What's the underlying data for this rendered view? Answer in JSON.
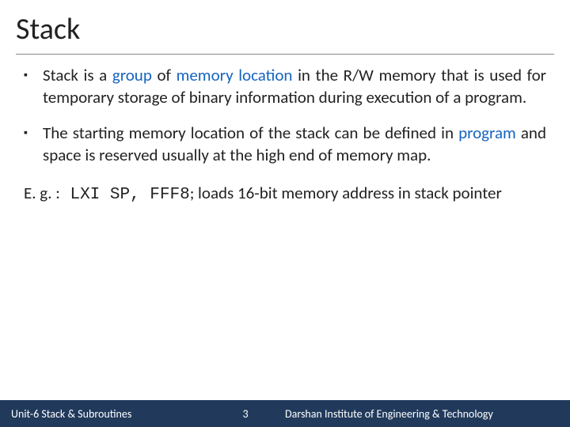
{
  "title": "Stack",
  "bullets": [
    {
      "pre": "Stack is a ",
      "blue1": "group",
      "mid1": " of ",
      "blue2": "memory location",
      "post": " in the R/W memory that is used for temporary storage of binary information during execution of a program."
    },
    {
      "pre": "The starting memory location of the stack can be defined in ",
      "blue1": "program",
      "mid1": "",
      "blue2": "",
      "post": " and space is reserved usually at the high end of memory map."
    }
  ],
  "example": {
    "prefix": "E. g. :",
    "code": " LXI SP, FFF8",
    "suffix": "; loads 16-bit memory address in stack pointer"
  },
  "footer": {
    "left": "Unit-6 Stack & Subroutines",
    "num": "3",
    "right": "Darshan Institute of Engineering & Technology"
  }
}
